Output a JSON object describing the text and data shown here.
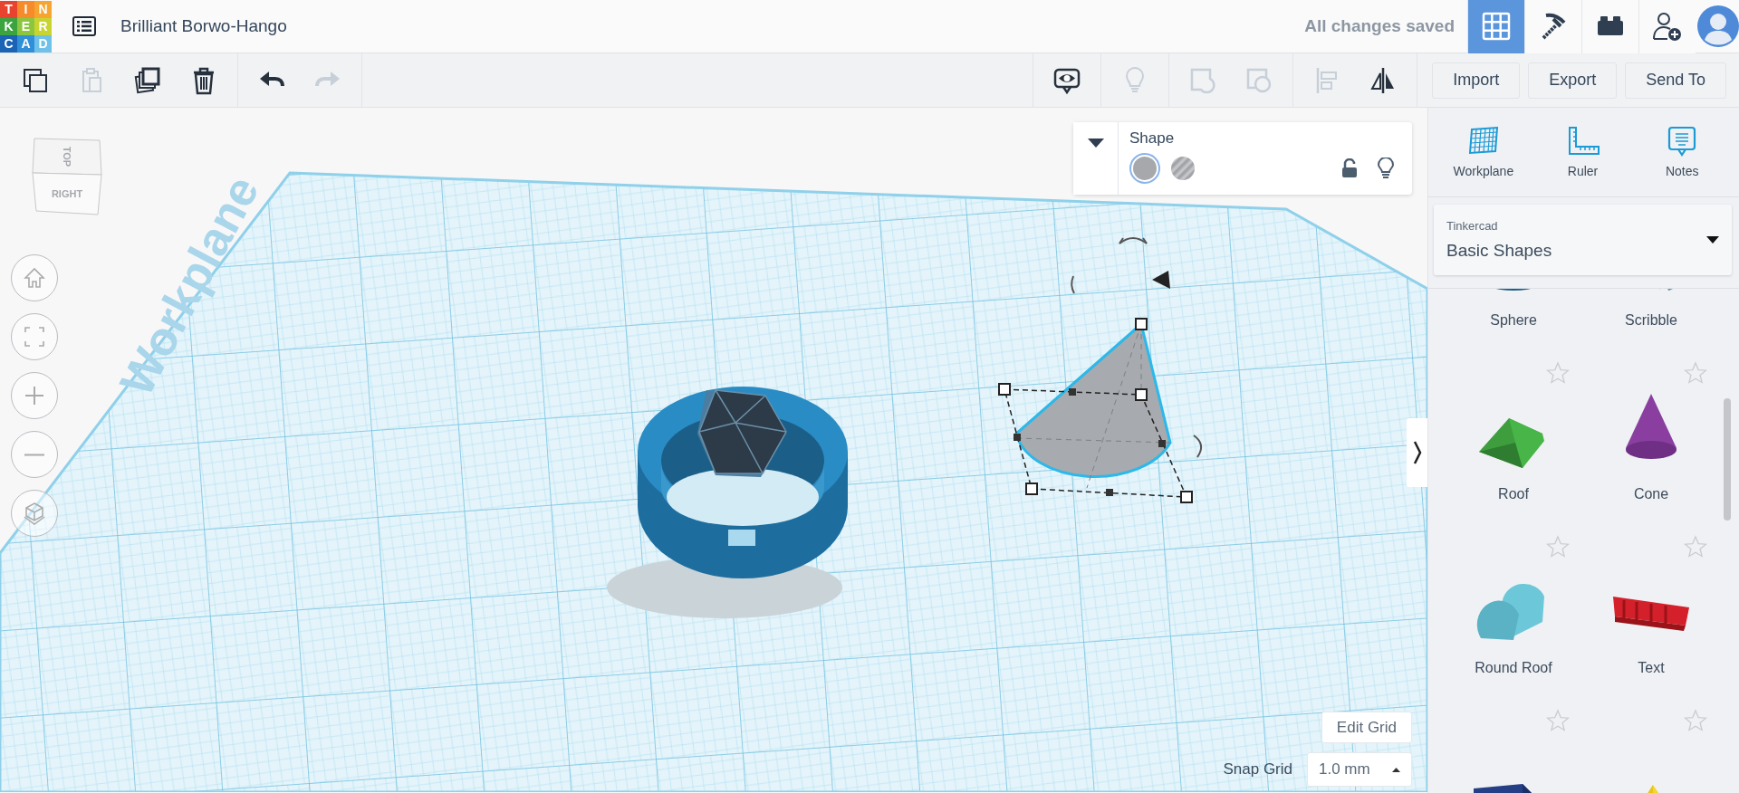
{
  "header": {
    "logo_letters": [
      {
        "letter": "T",
        "color": "#e8432e"
      },
      {
        "letter": "I",
        "color": "#f58b2a"
      },
      {
        "letter": "N",
        "color": "#f7a531"
      },
      {
        "letter": "K",
        "color": "#3ba43f"
      },
      {
        "letter": "E",
        "color": "#8cc63f"
      },
      {
        "letter": "R",
        "color": "#c8d531"
      },
      {
        "letter": "C",
        "color": "#1b63b4"
      },
      {
        "letter": "A",
        "color": "#2f8fd8"
      },
      {
        "letter": "D",
        "color": "#6fc1ea"
      }
    ],
    "design_title": "Brilliant Borwo-Hango",
    "save_status": "All changes saved",
    "mode_buttons": [
      {
        "kind": "design",
        "selected": true
      },
      {
        "kind": "blocks",
        "selected": false
      },
      {
        "kind": "bricks",
        "selected": false
      }
    ]
  },
  "toolbar": {
    "edit_tool_groups": [
      [
        {
          "kind": "copy",
          "disabled": false
        },
        {
          "kind": "paste",
          "disabled": true
        },
        {
          "kind": "duplicate",
          "disabled": false
        },
        {
          "kind": "delete",
          "disabled": false
        }
      ],
      [
        {
          "kind": "undo",
          "disabled": false
        },
        {
          "kind": "redo",
          "disabled": true
        }
      ]
    ],
    "view_tool_groups": [
      [
        {
          "kind": "notes_toggle",
          "disabled": false
        }
      ],
      [
        {
          "kind": "bulb",
          "disabled": true
        }
      ],
      [
        {
          "kind": "group",
          "disabled": true
        },
        {
          "kind": "hole",
          "disabled": true
        }
      ],
      [
        {
          "kind": "align",
          "disabled": true
        },
        {
          "kind": "mirror",
          "disabled": false
        }
      ]
    ],
    "actions": [
      "Import",
      "Export",
      "Send To"
    ]
  },
  "viewport": {
    "view_cube": {
      "top": "TOP",
      "right": "RIGHT"
    },
    "nav_buttons": [
      {
        "kind": "home"
      },
      {
        "kind": "fit"
      },
      {
        "kind": "zoom_in"
      },
      {
        "kind": "zoom_out"
      },
      {
        "kind": "perspective"
      }
    ],
    "workplane_label": "Workplane",
    "shape_inspector": {
      "title": "Shape",
      "options": [
        {
          "kind": "solid",
          "selected": true
        },
        {
          "kind": "hole",
          "selected": false
        }
      ],
      "locked": false,
      "hidden": false
    },
    "edit_grid": "Edit Grid",
    "snap_grid_label": "Snap Grid",
    "snap_grid_value": "1.0 mm"
  },
  "panel": {
    "tools": [
      {
        "kind": "workplane",
        "label": "Workplane"
      },
      {
        "kind": "ruler",
        "label": "Ruler"
      },
      {
        "kind": "notes",
        "label": "Notes"
      }
    ],
    "library": {
      "source": "Tinkercad",
      "category": "Basic Shapes"
    },
    "shapes": [
      {
        "kind": "sphere",
        "label": "Sphere"
      },
      {
        "kind": "scribble",
        "label": "Scribble"
      },
      {
        "kind": "roof",
        "label": "Roof"
      },
      {
        "kind": "cone",
        "label": "Cone"
      },
      {
        "kind": "round_roof",
        "label": "Round Roof"
      },
      {
        "kind": "text",
        "label": "Text"
      },
      {
        "kind": "box"
      },
      {
        "kind": "pyramid"
      }
    ]
  }
}
